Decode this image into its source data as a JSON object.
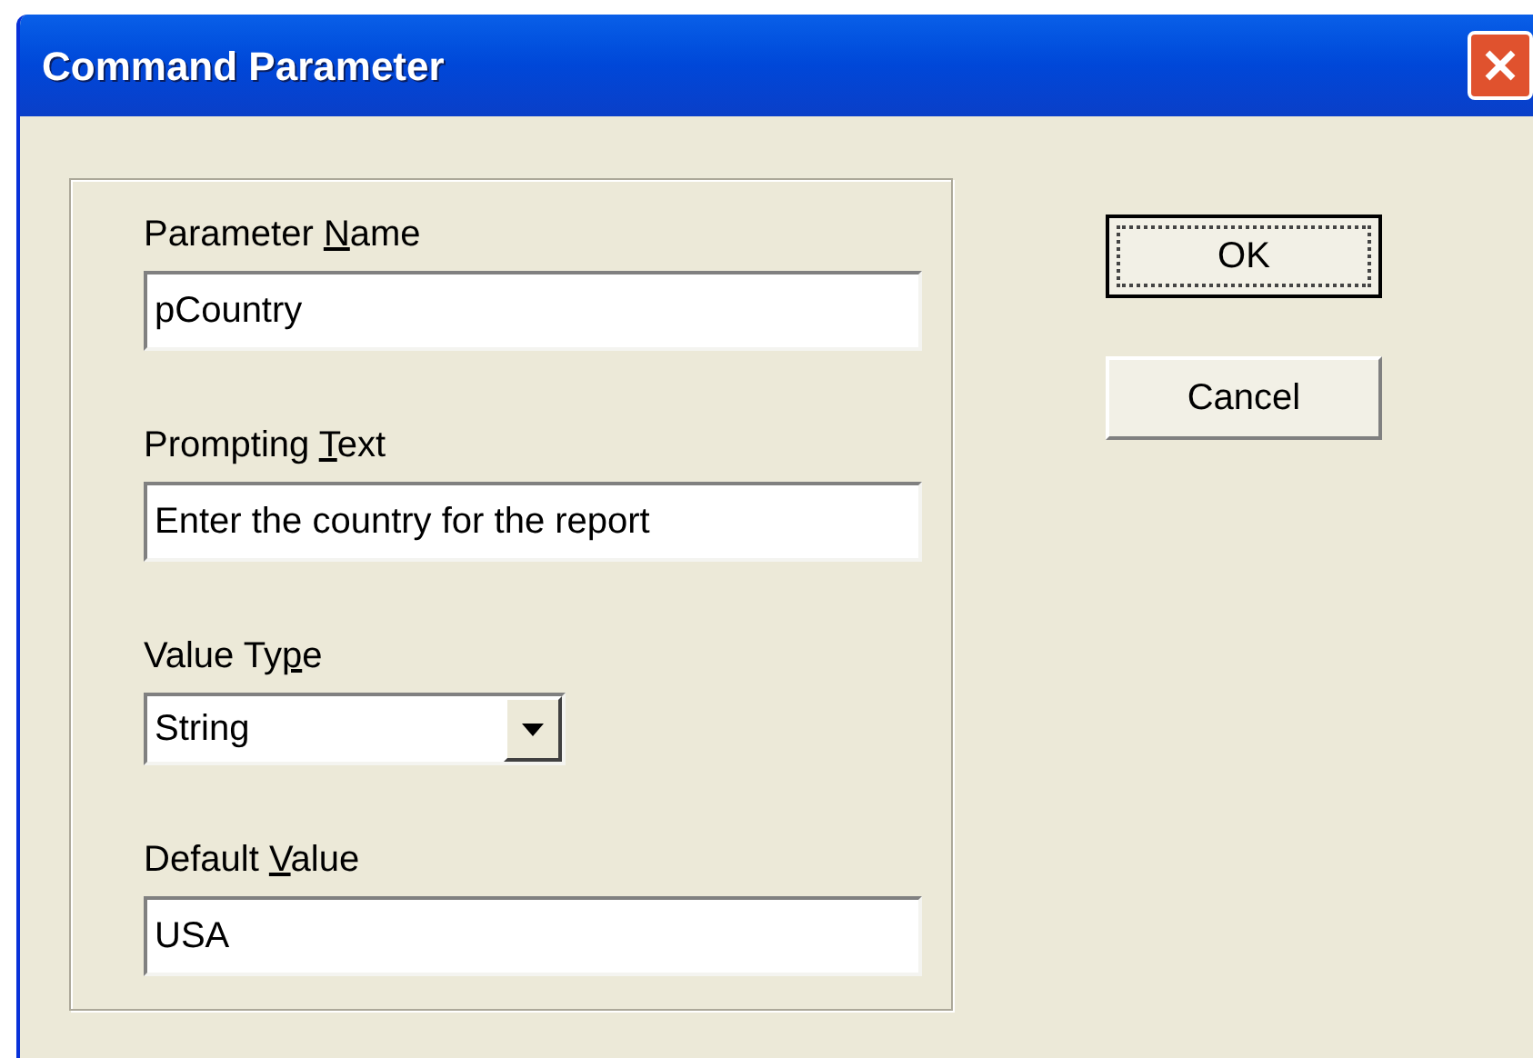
{
  "window": {
    "title": "Command Parameter"
  },
  "fields": [
    {
      "kind": "text",
      "label": {
        "before": "Parameter ",
        "key": "N",
        "after": "ame"
      },
      "value": "pCountry"
    },
    {
      "kind": "text",
      "label": {
        "before": "Prompting ",
        "key": "T",
        "after": "ext"
      },
      "value": "Enter the country for the report"
    },
    {
      "kind": "dropdown",
      "label": {
        "before": "Value Ty",
        "key": "p",
        "after": "e"
      },
      "value": "String"
    },
    {
      "kind": "text",
      "label": {
        "before": "Default ",
        "key": "V",
        "after": "alue"
      },
      "value": "USA"
    }
  ],
  "buttons": [
    {
      "label": "OK",
      "focused": true
    },
    {
      "label": "Cancel",
      "focused": false
    }
  ]
}
